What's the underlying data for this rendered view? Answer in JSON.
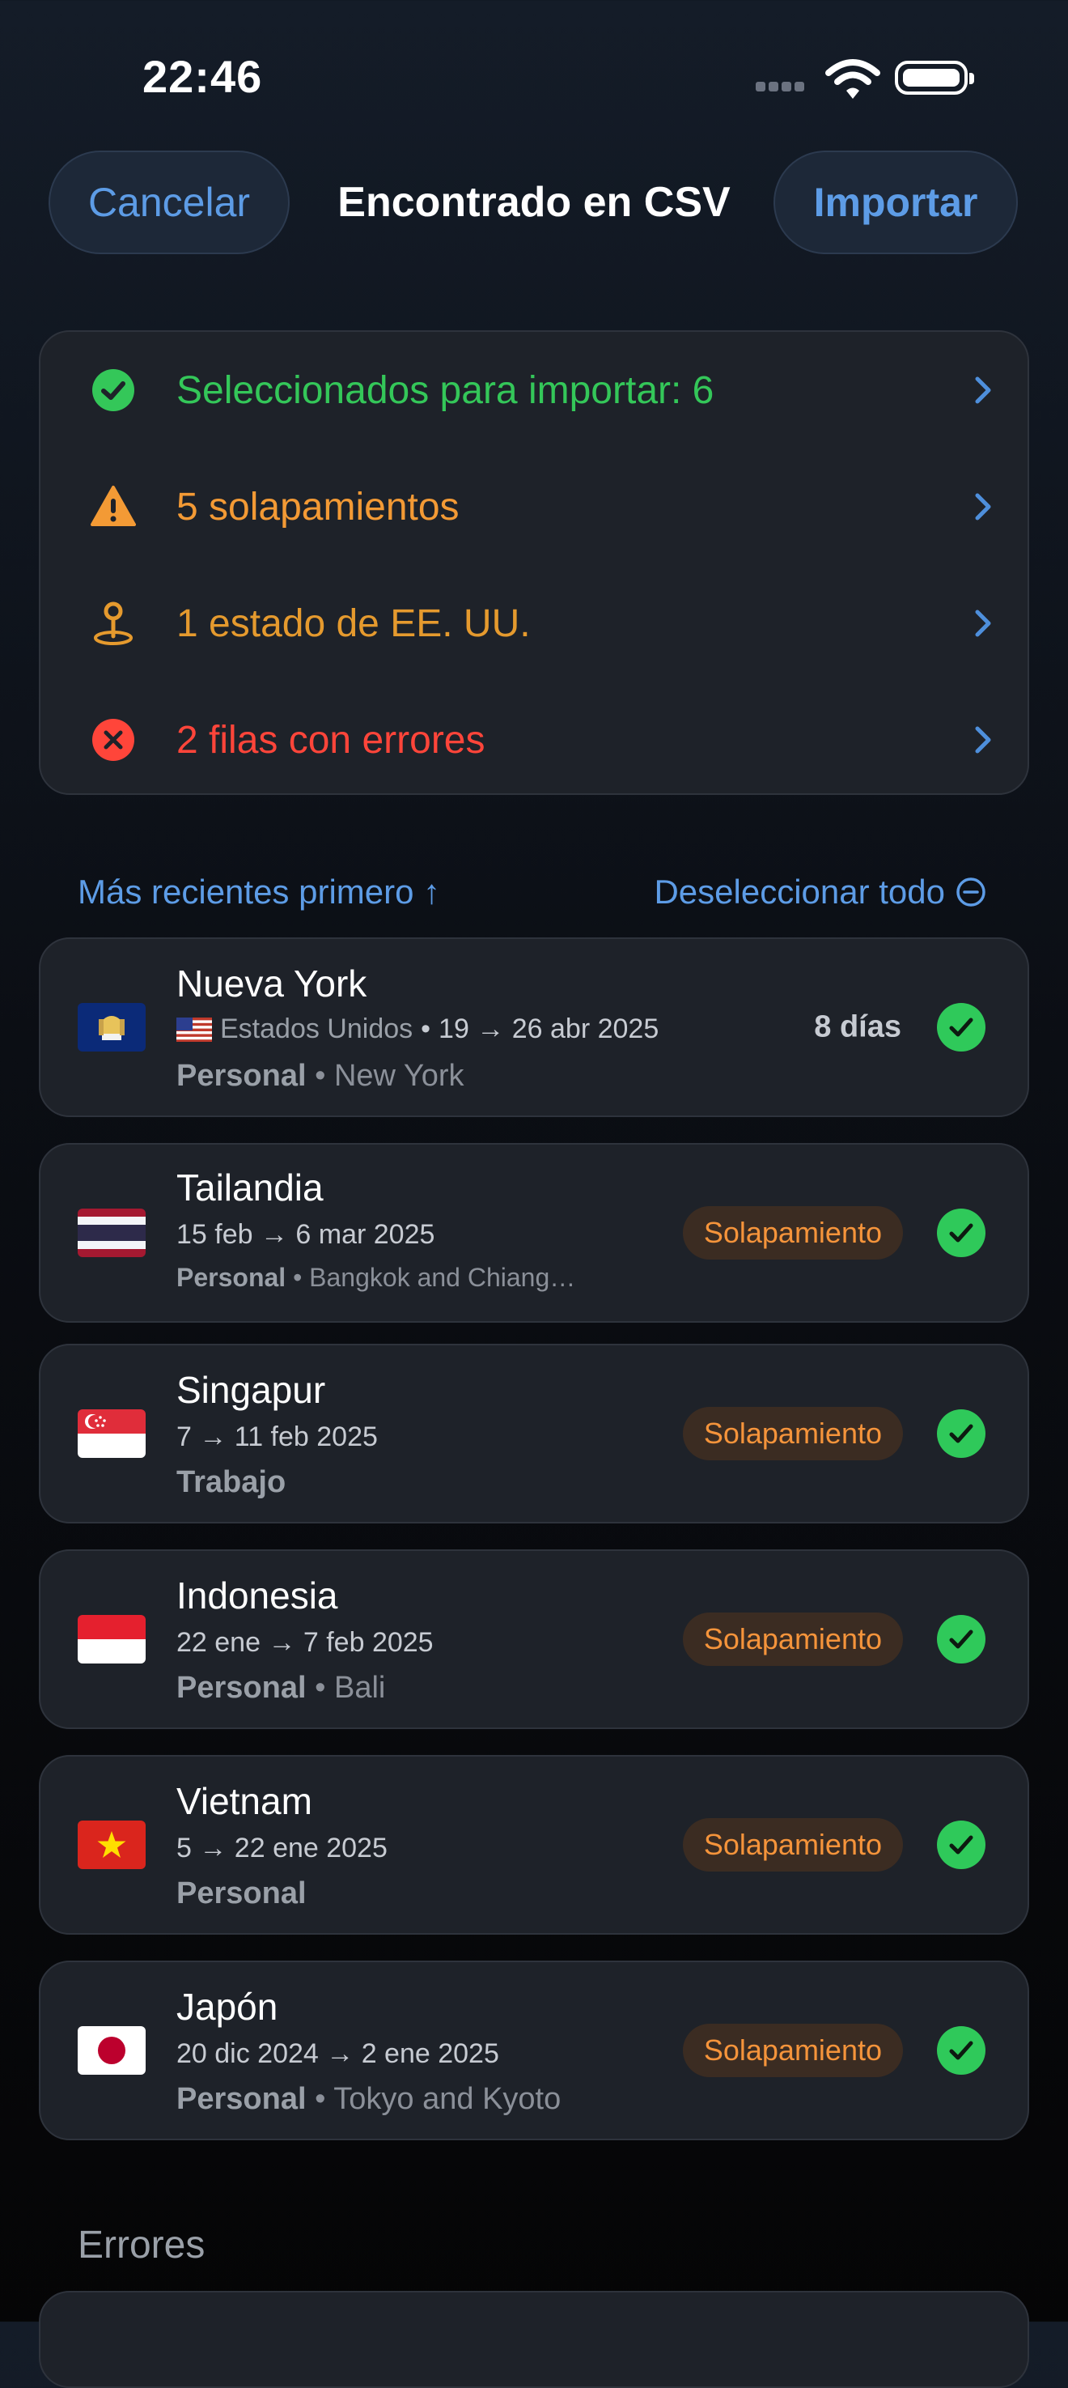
{
  "status_bar": {
    "time": "22:46"
  },
  "nav": {
    "cancel_label": "Cancelar",
    "title": "Encontrado en CSV",
    "import_label": "Importar"
  },
  "summary": [
    {
      "icon": "check-circle-icon",
      "text": "Seleccionados para importar: 6",
      "color": "#34c759"
    },
    {
      "icon": "warning-triangle-icon",
      "text": "5 solapamientos",
      "color": "#f39a35"
    },
    {
      "icon": "location-pin-icon",
      "text": "1 estado de EE. UU.",
      "color": "#e59a2e"
    },
    {
      "icon": "error-circle-icon",
      "text": "2 filas con errores",
      "color": "#ff453a"
    }
  ],
  "sort": {
    "order_label": "Más recientes primero ↑",
    "deselect_label": "Deseleccionar todo"
  },
  "trips": [
    {
      "name": "Nueva York",
      "country": "Estados Unidos",
      "dates": "19 → 26 abr 2025",
      "category": "Personal",
      "note": "New York",
      "duration": "8 días",
      "flag": "new-york-flag-icon",
      "small_flag": "us-flag-icon"
    },
    {
      "name": "Tailandia",
      "dates": "15 feb → 6 mar 2025",
      "category": "Personal",
      "note": "Bangkok and Chiang…",
      "badge": "Solapamiento",
      "flag": "thailand-flag-icon"
    },
    {
      "name": "Singapur",
      "dates": "7 → 11 feb 2025",
      "category": "Trabajo",
      "note": "",
      "badge": "Solapamiento",
      "flag": "singapore-flag-icon"
    },
    {
      "name": "Indonesia",
      "dates": "22 ene → 7 feb 2025",
      "category": "Personal",
      "note": "Bali",
      "badge": "Solapamiento",
      "flag": "indonesia-flag-icon"
    },
    {
      "name": "Vietnam",
      "dates": "5 → 22 ene 2025",
      "category": "Personal",
      "note": "",
      "badge": "Solapamiento",
      "flag": "vietnam-flag-icon"
    },
    {
      "name": "Japón",
      "dates": "20 dic 2024 → 2 ene 2025",
      "category": "Personal",
      "note": "Tokyo and Kyoto",
      "badge": "Solapamiento",
      "flag": "japan-flag-icon"
    }
  ],
  "errors": {
    "title": "Errores"
  },
  "dot": "•"
}
